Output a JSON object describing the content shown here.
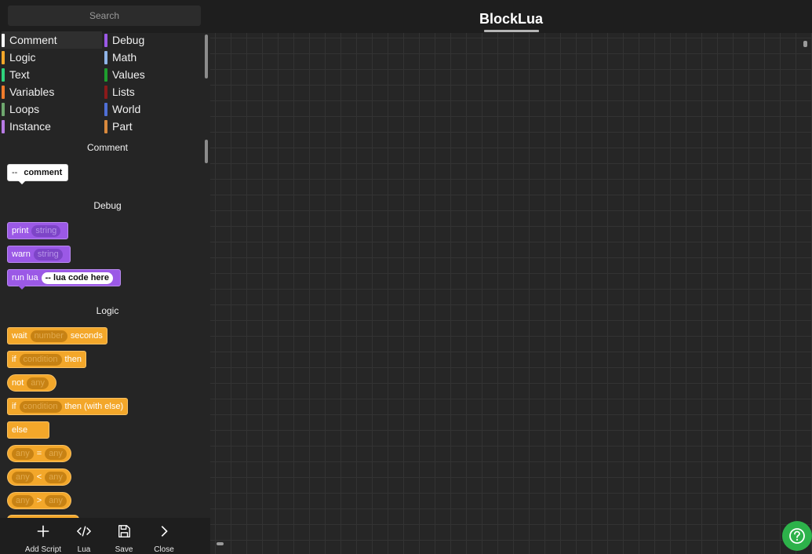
{
  "search": {
    "placeholder": "Search"
  },
  "header": {
    "title": "BlockLua"
  },
  "categories": [
    {
      "label": "Comment",
      "color": "#ffffff"
    },
    {
      "label": "Debug",
      "color": "#9b59e6"
    },
    {
      "label": "Logic",
      "color": "#f3a72a"
    },
    {
      "label": "Math",
      "color": "#8fb4e8"
    },
    {
      "label": "Text",
      "color": "#2ed27c"
    },
    {
      "label": "Values",
      "color": "#1e9e2e"
    },
    {
      "label": "Variables",
      "color": "#f07c2c"
    },
    {
      "label": "Lists",
      "color": "#8b1a1a"
    },
    {
      "label": "Loops",
      "color": "#6fa86f"
    },
    {
      "label": "World",
      "color": "#4f6fd6"
    },
    {
      "label": "Instance",
      "color": "#b77be4"
    },
    {
      "label": "Part",
      "color": "#d9893d"
    }
  ],
  "flyout": {
    "comment_section": "Comment",
    "comment_block": {
      "dash": "--",
      "text": "comment"
    },
    "debug_section": "Debug",
    "print": {
      "label": "print",
      "slot": "string"
    },
    "warn": {
      "label": "warn",
      "slot": "string"
    },
    "run_lua": {
      "label": "run lua",
      "slot": "-- lua code here"
    },
    "logic_section": "Logic",
    "wait": {
      "label": "wait",
      "slot": "number",
      "suffix": "seconds"
    },
    "if_then": {
      "label": "if",
      "slot": "condition",
      "suffix": "then"
    },
    "not": {
      "label": "not",
      "slot": "any"
    },
    "if_else": {
      "label": "if",
      "slot": "condition",
      "suffix": "then (with else)"
    },
    "else": {
      "label": "else"
    },
    "eq": {
      "left": "any",
      "op": "=",
      "right": "any"
    },
    "lt": {
      "left": "any",
      "op": "<",
      "right": "any"
    },
    "gt": {
      "left": "any",
      "op": ">",
      "right": "any"
    }
  },
  "toolbar": {
    "add_script": "Add Script",
    "lua": "Lua",
    "save": "Save",
    "close": "Close"
  },
  "colors": {
    "accent_help": "#2db24a",
    "workspace_bg": "#262626"
  }
}
